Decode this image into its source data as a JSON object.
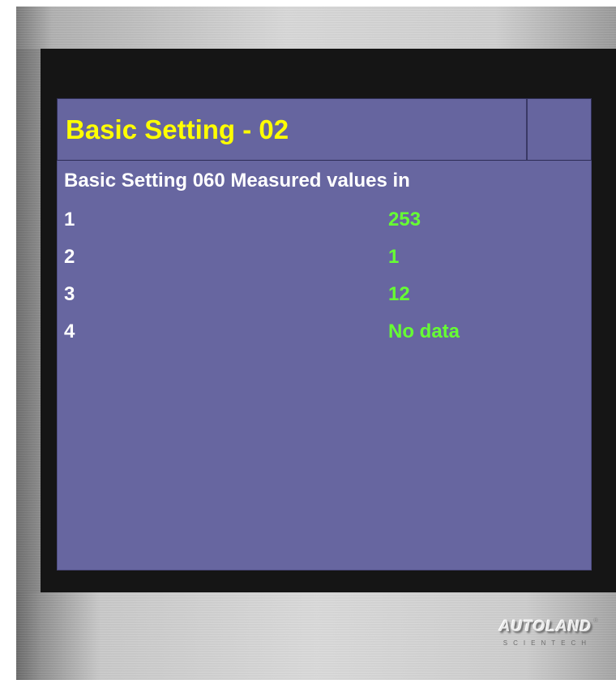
{
  "header": {
    "title": "Basic Setting - 02"
  },
  "main": {
    "subheader": "Basic Setting 060 Measured values in",
    "rows": [
      {
        "index": "1",
        "value": "253"
      },
      {
        "index": "2",
        "value": "1"
      },
      {
        "index": "3",
        "value": "12"
      },
      {
        "index": "4",
        "value": "No data"
      }
    ]
  },
  "brand": {
    "name": "AUTOLAND",
    "mark": "®",
    "tagline": "SCIENTECH"
  },
  "colors": {
    "screen_background": "#6766a0",
    "title_text": "#ffff00",
    "label_text": "#ffffff",
    "value_text": "#66ff33",
    "frame": "#151515"
  },
  "icons": {
    "title_corner": "blank-button-area"
  }
}
